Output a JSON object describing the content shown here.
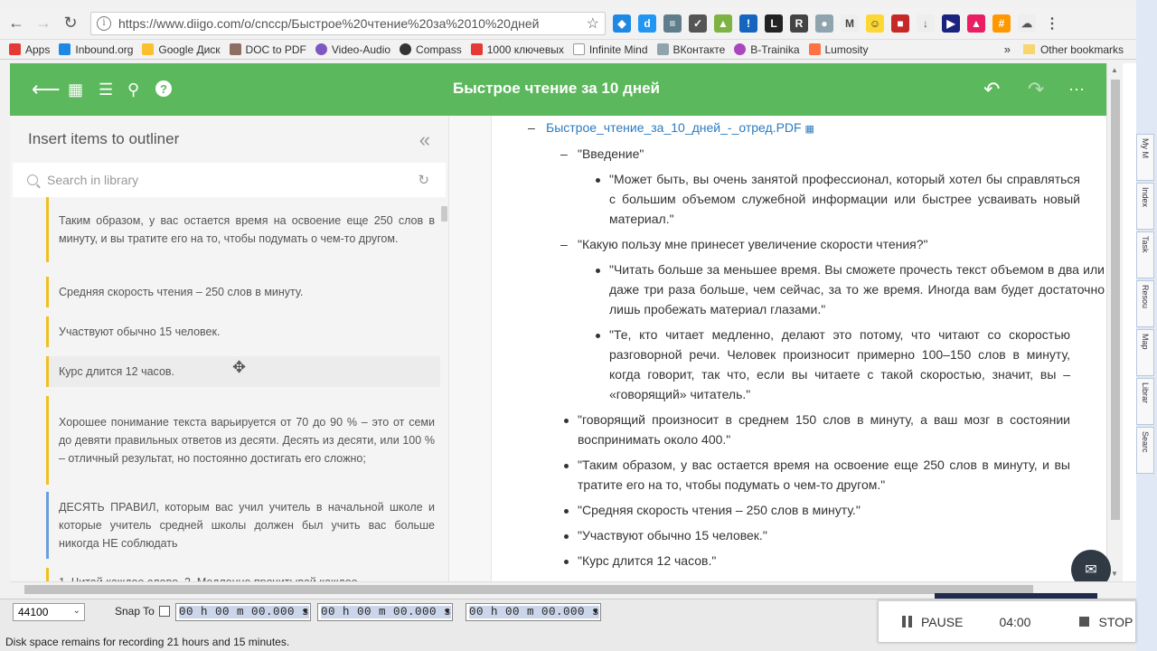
{
  "browser": {
    "url": "https://www.diigo.com/o/cnccp/Быстрое%20чтение%20за%2010%20дней",
    "bookmarks": [
      "Apps",
      "Inbound.org",
      "Google Диск",
      "DOC to PDF",
      "Video-Audio",
      "Compass",
      "1000 ключевых",
      "Infinite Mind",
      "ВКонтакте",
      "B-Trainika",
      "Lumosity"
    ],
    "bookmarks_more": "»",
    "other_bookmarks": "Other bookmarks"
  },
  "app": {
    "title": "Быстрое чтение за 10 дней",
    "panel_title": "Insert items to outliner",
    "search_placeholder": "Search in library",
    "library_items": [
      "Таким образом, у вас остается время на освоение еще 250 слов в минуту, и вы тратите его на то, чтобы подумать о чем-то другом.",
      "Средняя скорость чтения – 250 слов в минуту.",
      "Участвуют обычно 15 человек.",
      "Курс длится 12 часов.",
      "Хорошее понимание текста варьируется от 70 до 90 % – это от семи до девяти правильных ответов из десяти. Десять из десяти, или 100 % – отличный результат, но постоянно достигать его сложно;",
      "ДЕСЯТЬ ПРАВИЛ, которым вас учил учитель в начальной школе и которые учитель средней школы должен был учить вас больше никогда НЕ соблюдать",
      "1. Читай каждое слово. 2. Медленно прочитывай каждое"
    ],
    "outline": {
      "root": "Быстрое_чтение_за_10_дней_-_отред.PDF",
      "intro": "\"Введение\"",
      "intro_text": "\"Может быть, вы очень занятой профессионал, который хотел бы справляться с большим объемом служебной информации или быстрее усваивать новый материал.\"",
      "benefit": "\"Какую пользу мне принесет увеличение скорости чтения?\"",
      "benefit_1": "\"Читать больше за меньшее время. Вы сможете прочесть текст объемом в два или даже три раза больше, чем сейчас, за то же время. Иногда вам будет достаточно лишь пробежать материал глазами.\"",
      "benefit_2": "\"Те, кто читает медленно, делают это потому, что читают со скоростью разговорной речи. Человек произносит примерно 100–150 слов в минуту, когда говорит, так что, если вы читаете с такой скоростью, значит, вы – «говорящий» читатель.\"",
      "item_1": "\"говорящий произносит в среднем 150 слов в минуту, а ваш мозг в состоянии воспринимать около 400.\"",
      "item_2": "\"Таким образом, у вас остается время на освоение еще 250 слов в минуту, и вы тратите его на то, чтобы подумать о чем-то другом.\"",
      "item_3": "\"Средняя скорость чтения – 250 слов в минуту.\"",
      "item_4": "\"Участвуют обычно 15 человек.\"",
      "item_5": "\"Курс длится 12 часов.\""
    }
  },
  "sidebar_tabs": [
    "My M",
    "Index",
    "Task",
    "Resou",
    "Map",
    "Librar",
    "Searc"
  ],
  "recorder": {
    "sample_rate": "44100",
    "snap_label": "Snap To",
    "time_fields": [
      "00 h 00 m 00.000 s",
      "00 h 00 m 00.000 s",
      "00 h 00 m 00.000 s"
    ],
    "status": "Disk space remains for recording 21 hours and 15 minutes.",
    "pause_label": "PAUSE",
    "elapsed": "04:00",
    "stop_label": "STOP"
  },
  "colors": {
    "accent": "#5cb85c",
    "link": "#2a7bbf",
    "card_yellow": "#f0c020",
    "card_blue": "#6a9fdc"
  }
}
